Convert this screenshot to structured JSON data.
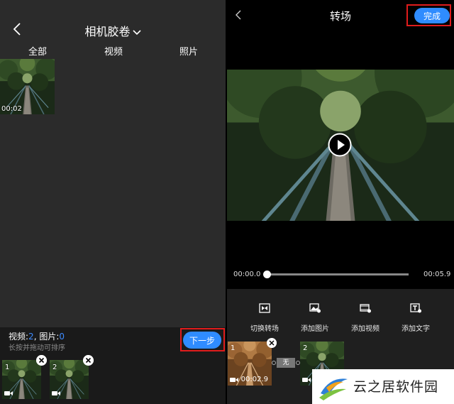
{
  "left": {
    "title": "相机胶卷",
    "tabs": [
      "全部",
      "视频",
      "照片"
    ],
    "media": [
      {
        "duration": "00:02"
      }
    ],
    "count_video_label": "视频:",
    "count_video": "2",
    "count_sep": ", ",
    "count_image_label": "图片:",
    "count_image": "0",
    "hint": "长按并拖动可排序",
    "next_label": "下一步",
    "selected": [
      {
        "index": "1"
      },
      {
        "index": "2"
      }
    ]
  },
  "right": {
    "title": "转场",
    "done_label": "完成",
    "time_start": "00:00.0",
    "time_end": "00:05.9",
    "progress": 0.0,
    "tools": [
      {
        "label": "切换转场",
        "icon": "transition-icon"
      },
      {
        "label": "添加图片",
        "icon": "add-image-icon"
      },
      {
        "label": "添加视频",
        "icon": "add-video-icon"
      },
      {
        "label": "添加文字",
        "icon": "add-text-icon"
      }
    ],
    "clips": [
      {
        "index": "1",
        "duration": "00:02.9"
      },
      {
        "index": "2"
      }
    ],
    "transition_label": "无"
  },
  "watermark": {
    "text": "云之居软件园"
  },
  "colors": {
    "accent": "#2f8cff",
    "highlight": "#e01c1c",
    "panel": "#2b2b2b"
  }
}
